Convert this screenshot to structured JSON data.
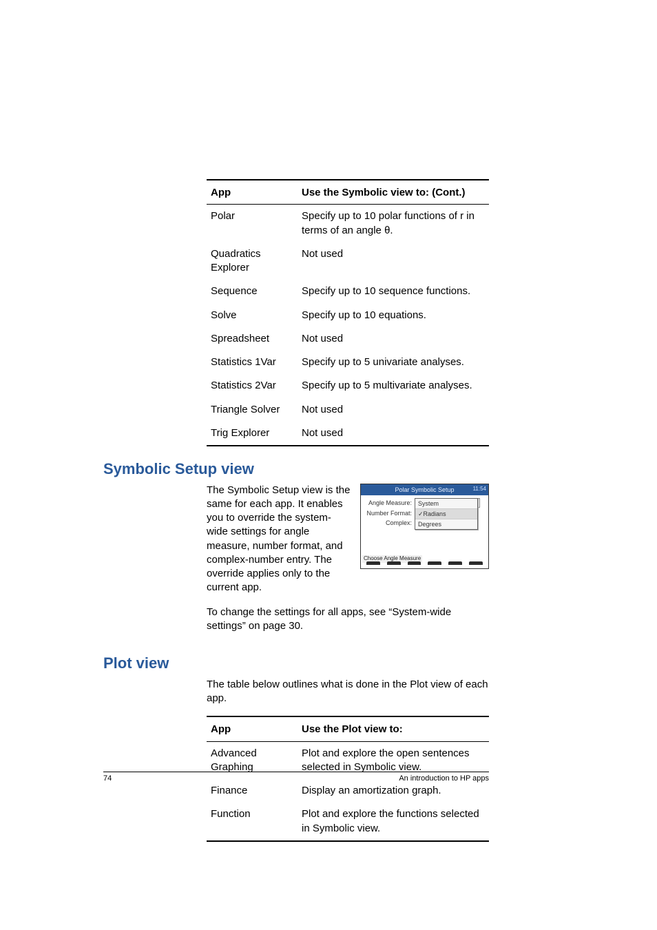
{
  "table1": {
    "h_app": "App",
    "h_use": "Use the Symbolic view to:  (Cont.)",
    "rows": [
      {
        "app": "Polar",
        "use": "Specify up to 10 polar functions of r in terms of an angle θ."
      },
      {
        "app": "Quadratics Explorer",
        "use": "Not used"
      },
      {
        "app": "Sequence",
        "use": "Specify up to 10 sequence functions."
      },
      {
        "app": "Solve",
        "use": "Specify up to 10 equations."
      },
      {
        "app": "Spreadsheet",
        "use": "Not used"
      },
      {
        "app": "Statistics 1Var",
        "use": "Specify up to 5 univariate analyses."
      },
      {
        "app": "Statistics 2Var",
        "use": "Specify up to 5 multivariate analyses."
      },
      {
        "app": "Triangle Solver",
        "use": "Not used"
      },
      {
        "app": "Trig Explorer",
        "use": "Not used"
      }
    ]
  },
  "section1": {
    "title": "Symbolic Setup view",
    "para": "The Symbolic Setup view is the same for each app. It enables you to override the system-wide settings for angle measure, number format, and complex-number entry. The override applies only to the current app.",
    "para2": "To change the settings for all apps, see “System-wide settings” on page 30."
  },
  "fig": {
    "title": "Polar Symbolic Setup",
    "time": "11:54",
    "row1_label": "Angle Measure:",
    "row2_label": "Number Format:",
    "row3_label": "Complex:",
    "menu_opt1": "System",
    "menu_opt2_prefix": "✓",
    "menu_opt2": "Radians",
    "menu_opt3": "Degrees",
    "row3_value": "System",
    "status": "Choose Angle Measure"
  },
  "section2": {
    "title": "Plot view",
    "intro": "The table below outlines what is done in the Plot view of each app."
  },
  "table2": {
    "h_app": "App",
    "h_use": "Use the Plot view to:",
    "rows": [
      {
        "app": "Advanced Graphing",
        "use": "Plot and explore the open sentences selected in Symbolic view."
      },
      {
        "app": "Finance",
        "use": "Display an amortization graph."
      },
      {
        "app": "Function",
        "use": "Plot and explore the functions selected in Symbolic view."
      }
    ]
  },
  "footer": {
    "page": "74",
    "title": "An introduction to HP apps"
  }
}
